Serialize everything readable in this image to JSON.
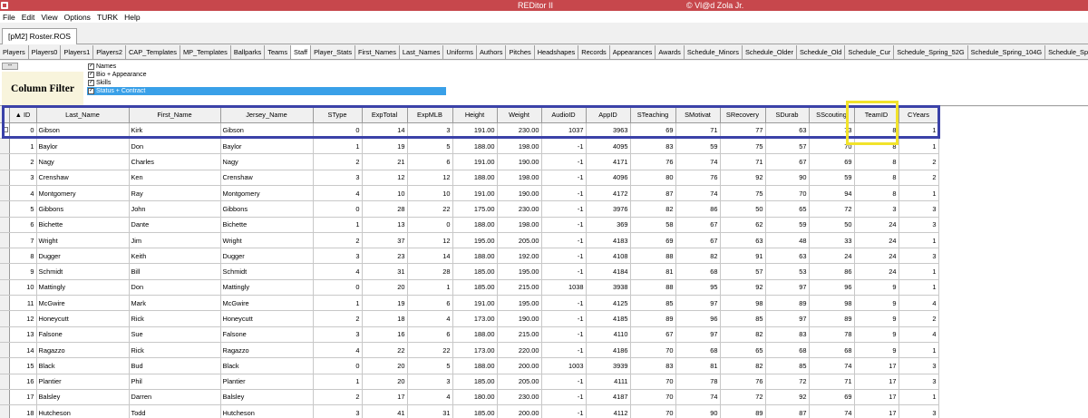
{
  "window": {
    "title": "REDitor II",
    "credit": "© Vl@d Zola Jr."
  },
  "menu": [
    "File",
    "Edit",
    "View",
    "Options",
    "TURK",
    "Help"
  ],
  "document_tab": "[pM2] Roster.ROS",
  "subtabs": [
    "Players",
    "Players0",
    "Players1",
    "Players2",
    "CAP_Templates",
    "MP_Templates",
    "Ballparks",
    "Teams",
    "Staff",
    "Player_Stats",
    "First_Names",
    "Last_Names",
    "Uniforms",
    "Authors",
    "Pitches",
    "Headshapes",
    "Records",
    "Appearances",
    "Awards",
    "Schedule_Minors",
    "Schedule_Older",
    "Schedule_Old",
    "Schedule_Cur",
    "Schedule_Spring_52G",
    "Schedule_Spring_104G",
    "Schedule_Spring_"
  ],
  "active_subtab": "Staff",
  "filter": {
    "small_button": "--",
    "label": "Column Filter",
    "options": [
      {
        "label": "Names",
        "checked": true,
        "selected": false
      },
      {
        "label": "Bio + Appearance",
        "checked": true,
        "selected": false
      },
      {
        "label": "Skills",
        "checked": true,
        "selected": false
      },
      {
        "label": "Status + Contract",
        "checked": true,
        "selected": true
      }
    ]
  },
  "table": {
    "columns": [
      "▲ ID",
      "Last_Name",
      "First_Name",
      "Jersey_Name",
      "SType",
      "ExpTotal",
      "ExpMLB",
      "Height",
      "Weight",
      "AudioID",
      "AppID",
      "STeaching",
      "SMotivat",
      "SRecovery",
      "SDurab",
      "SScouting",
      "TeamID",
      "CYears"
    ],
    "rows": [
      [
        "0",
        "Gibson",
        "Kirk",
        "Gibson",
        "0",
        "14",
        "3",
        "191.00",
        "230.00",
        "1037",
        "3963",
        "69",
        "71",
        "77",
        "63",
        "73",
        "8",
        "1"
      ],
      [
        "1",
        "Baylor",
        "Don",
        "Baylor",
        "1",
        "19",
        "5",
        "188.00",
        "198.00",
        "-1",
        "4095",
        "83",
        "59",
        "75",
        "57",
        "70",
        "8",
        "1"
      ],
      [
        "2",
        "Nagy",
        "Charles",
        "Nagy",
        "2",
        "21",
        "6",
        "191.00",
        "190.00",
        "-1",
        "4171",
        "76",
        "74",
        "71",
        "67",
        "69",
        "8",
        "2"
      ],
      [
        "3",
        "Crenshaw",
        "Ken",
        "Crenshaw",
        "3",
        "12",
        "12",
        "188.00",
        "198.00",
        "-1",
        "4096",
        "80",
        "76",
        "92",
        "90",
        "59",
        "8",
        "2"
      ],
      [
        "4",
        "Montgomery",
        "Ray",
        "Montgomery",
        "4",
        "10",
        "10",
        "191.00",
        "190.00",
        "-1",
        "4172",
        "87",
        "74",
        "75",
        "70",
        "94",
        "8",
        "1"
      ],
      [
        "5",
        "Gibbons",
        "John",
        "Gibbons",
        "0",
        "28",
        "22",
        "175.00",
        "230.00",
        "-1",
        "3976",
        "82",
        "86",
        "50",
        "65",
        "72",
        "3",
        "3"
      ],
      [
        "6",
        "Bichette",
        "Dante",
        "Bichette",
        "1",
        "13",
        "0",
        "188.00",
        "198.00",
        "-1",
        "369",
        "58",
        "67",
        "62",
        "59",
        "50",
        "24",
        "3"
      ],
      [
        "7",
        "Wright",
        "Jim",
        "Wright",
        "2",
        "37",
        "12",
        "195.00",
        "205.00",
        "-1",
        "4183",
        "69",
        "67",
        "63",
        "48",
        "33",
        "24",
        "1"
      ],
      [
        "8",
        "Dugger",
        "Keith",
        "Dugger",
        "3",
        "23",
        "14",
        "188.00",
        "192.00",
        "-1",
        "4108",
        "88",
        "82",
        "91",
        "63",
        "24",
        "24",
        "3"
      ],
      [
        "9",
        "Schmidt",
        "Bill",
        "Schmidt",
        "4",
        "31",
        "28",
        "185.00",
        "195.00",
        "-1",
        "4184",
        "81",
        "68",
        "57",
        "53",
        "86",
        "24",
        "1"
      ],
      [
        "10",
        "Mattingly",
        "Don",
        "Mattingly",
        "0",
        "20",
        "1",
        "185.00",
        "215.00",
        "1038",
        "3938",
        "88",
        "95",
        "92",
        "97",
        "96",
        "9",
        "1"
      ],
      [
        "11",
        "McGwire",
        "Mark",
        "McGwire",
        "1",
        "19",
        "6",
        "191.00",
        "195.00",
        "-1",
        "4125",
        "85",
        "97",
        "98",
        "89",
        "98",
        "9",
        "4"
      ],
      [
        "12",
        "Honeycutt",
        "Rick",
        "Honeycutt",
        "2",
        "18",
        "4",
        "173.00",
        "190.00",
        "-1",
        "4185",
        "89",
        "96",
        "85",
        "97",
        "89",
        "9",
        "2"
      ],
      [
        "13",
        "Falsone",
        "Sue",
        "Falsone",
        "3",
        "16",
        "6",
        "188.00",
        "215.00",
        "-1",
        "4110",
        "67",
        "97",
        "82",
        "83",
        "78",
        "9",
        "4"
      ],
      [
        "14",
        "Ragazzo",
        "Rick",
        "Ragazzo",
        "4",
        "22",
        "22",
        "173.00",
        "220.00",
        "-1",
        "4186",
        "70",
        "68",
        "65",
        "68",
        "68",
        "9",
        "1"
      ],
      [
        "15",
        "Black",
        "Bud",
        "Black",
        "0",
        "20",
        "5",
        "188.00",
        "200.00",
        "1003",
        "3939",
        "83",
        "81",
        "82",
        "85",
        "74",
        "17",
        "3"
      ],
      [
        "16",
        "Plantier",
        "Phil",
        "Plantier",
        "1",
        "20",
        "3",
        "185.00",
        "205.00",
        "-1",
        "4111",
        "70",
        "78",
        "76",
        "72",
        "71",
        "17",
        "3"
      ],
      [
        "17",
        "Balsley",
        "Darren",
        "Balsley",
        "2",
        "17",
        "4",
        "180.00",
        "230.00",
        "-1",
        "4187",
        "70",
        "74",
        "72",
        "92",
        "69",
        "17",
        "1"
      ],
      [
        "18",
        "Hutcheson",
        "Todd",
        "Hutcheson",
        "3",
        "41",
        "31",
        "185.00",
        "200.00",
        "-1",
        "4112",
        "70",
        "90",
        "89",
        "87",
        "74",
        "17",
        "3"
      ]
    ]
  },
  "colors": {
    "titlebar": "#c7474c",
    "highlight_blue": "#3b42a8",
    "highlight_yellow": "#f2e32a",
    "filter_selected": "#39a0e8"
  }
}
